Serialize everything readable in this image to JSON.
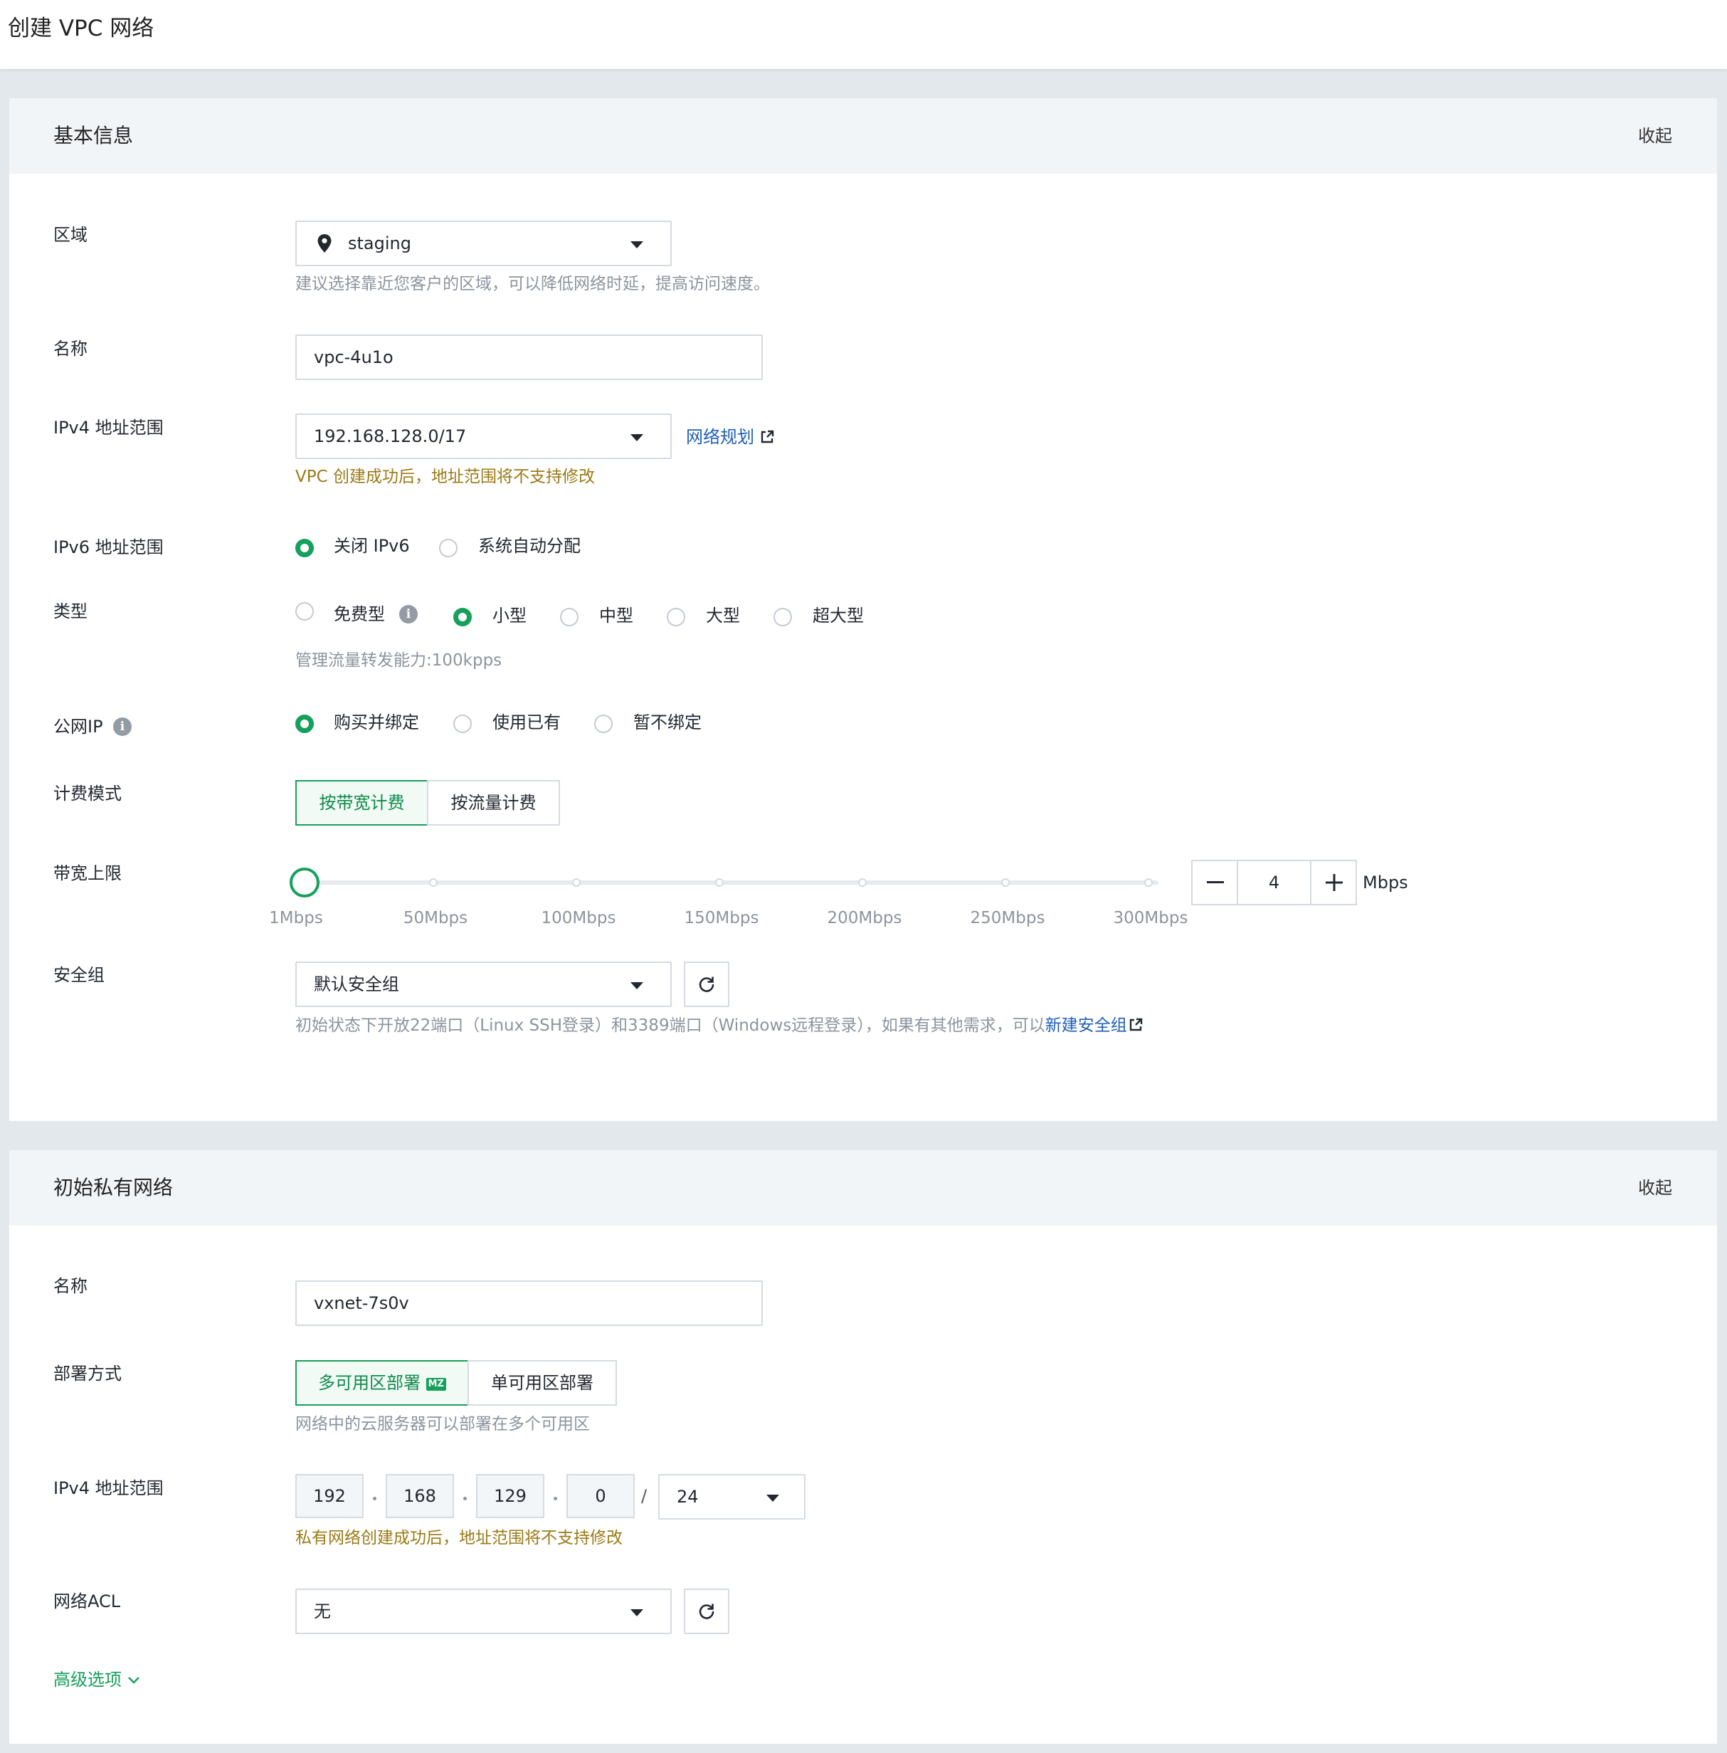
{
  "page": {
    "title": "创建 VPC 网络"
  },
  "basic": {
    "title": "基本信息",
    "collapse": "收起",
    "region": {
      "label": "区域",
      "value": "staging",
      "icon": "location-pin-icon",
      "hint": "建议选择靠近您客户的区域，可以降低网络时延，提高访问速度。"
    },
    "name": {
      "label": "名称",
      "value": "vpc-4u1o"
    },
    "ipv4": {
      "label": "IPv4 地址范围",
      "value": "192.168.128.0/17",
      "link": "网络规划",
      "warning": "VPC 创建成功后，地址范围将不支持修改"
    },
    "ipv6": {
      "label": "IPv6 地址范围",
      "options": [
        "关闭 IPv6",
        "系统自动分配"
      ],
      "selected": "关闭 IPv6"
    },
    "type": {
      "label": "类型",
      "options": [
        "免费型",
        "小型",
        "中型",
        "大型",
        "超大型"
      ],
      "selected": "小型",
      "hint": "管理流量转发能力:100kpps"
    },
    "public_ip": {
      "label": "公网IP",
      "options": [
        "购买并绑定",
        "使用已有",
        "暂不绑定"
      ],
      "selected": "购买并绑定"
    },
    "billing": {
      "label": "计费模式",
      "options": [
        "按带宽计费",
        "按流量计费"
      ],
      "selected": "按带宽计费"
    },
    "bandwidth": {
      "label": "带宽上限",
      "ticks": [
        "1Mbps",
        "50Mbps",
        "100Mbps",
        "150Mbps",
        "200Mbps",
        "250Mbps",
        "300Mbps"
      ],
      "value": "4",
      "unit": "Mbps",
      "min": 1,
      "max": 300,
      "current": 4
    },
    "security_group": {
      "label": "安全组",
      "value": "默认安全组",
      "hint": "初始状态下开放22端口（Linux SSH登录）和3389端口（Windows远程登录），如果有其他需求，可以",
      "link": "新建安全组"
    }
  },
  "vxnet": {
    "title": "初始私有网络",
    "collapse": "收起",
    "name": {
      "label": "名称",
      "value": "vxnet-7s0v"
    },
    "deploy": {
      "label": "部署方式",
      "options": [
        "多可用区部署",
        "单可用区部署"
      ],
      "selected": "多可用区部署",
      "badge": "MZ",
      "hint": "网络中的云服务器可以部署在多个可用区"
    },
    "ipv4": {
      "label": "IPv4 地址范围",
      "octets": [
        "192",
        "168",
        "129",
        "0"
      ],
      "slash": "/",
      "prefix": "24",
      "warning": "私有网络创建成功后，地址范围将不支持修改"
    },
    "acl": {
      "label": "网络ACL",
      "value": "无"
    },
    "advanced": "高级选项"
  },
  "colors": {
    "accent": "#16a05c",
    "link": "#1f5fb8",
    "warning": "#9a7a16",
    "hint": "#8c949e"
  }
}
